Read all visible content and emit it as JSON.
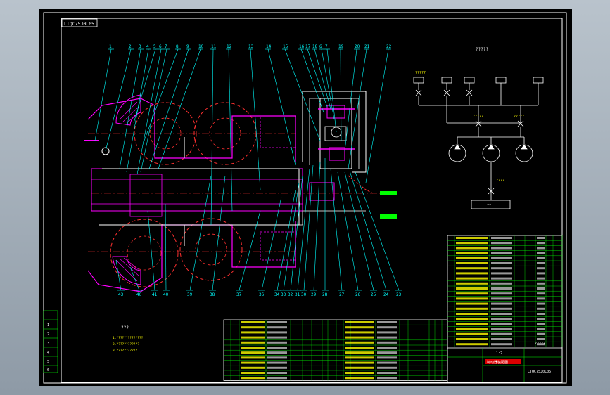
{
  "drawing": {
    "code_label": "LTQC75J0L05",
    "title_block_name": "制动器装配图",
    "title_block_code": "LTQC75J0L05",
    "scale_label": "1:2",
    "project": "?????"
  },
  "hydraulic": {
    "title": "?????",
    "tanks_label": "?????",
    "valve_left_label": "?????",
    "valve_right_label": "?????",
    "pump_label": "????",
    "reservoir_label": "??"
  },
  "callouts_top": [
    "1",
    "2",
    "3",
    "4",
    "5",
    "6",
    "7",
    "8",
    "9",
    "10",
    "11",
    "12",
    "13",
    "14",
    "15",
    "16",
    "17",
    "18",
    "6",
    "7",
    "19",
    "20",
    "21",
    "22"
  ],
  "callouts_bottom": [
    "43",
    "40",
    "41",
    "40",
    "39",
    "38",
    "37",
    "36",
    "34",
    "33",
    "32",
    "31",
    "30",
    "29",
    "28",
    "27",
    "26",
    "25",
    "24",
    "23"
  ],
  "tech_notes": {
    "title": "???",
    "lines": [
      "1.??????????????",
      "2.????????????",
      "3.???????????"
    ]
  },
  "revision_column": [
    "",
    "1",
    "2",
    "3",
    "4",
    "5",
    "6"
  ],
  "colors": {
    "line": "#ffffff",
    "accent_cyan": "#00ffff",
    "magenta": "#ff00ff",
    "red": "#ff3030",
    "green": "#00ff00",
    "yellow": "#ffff00"
  }
}
